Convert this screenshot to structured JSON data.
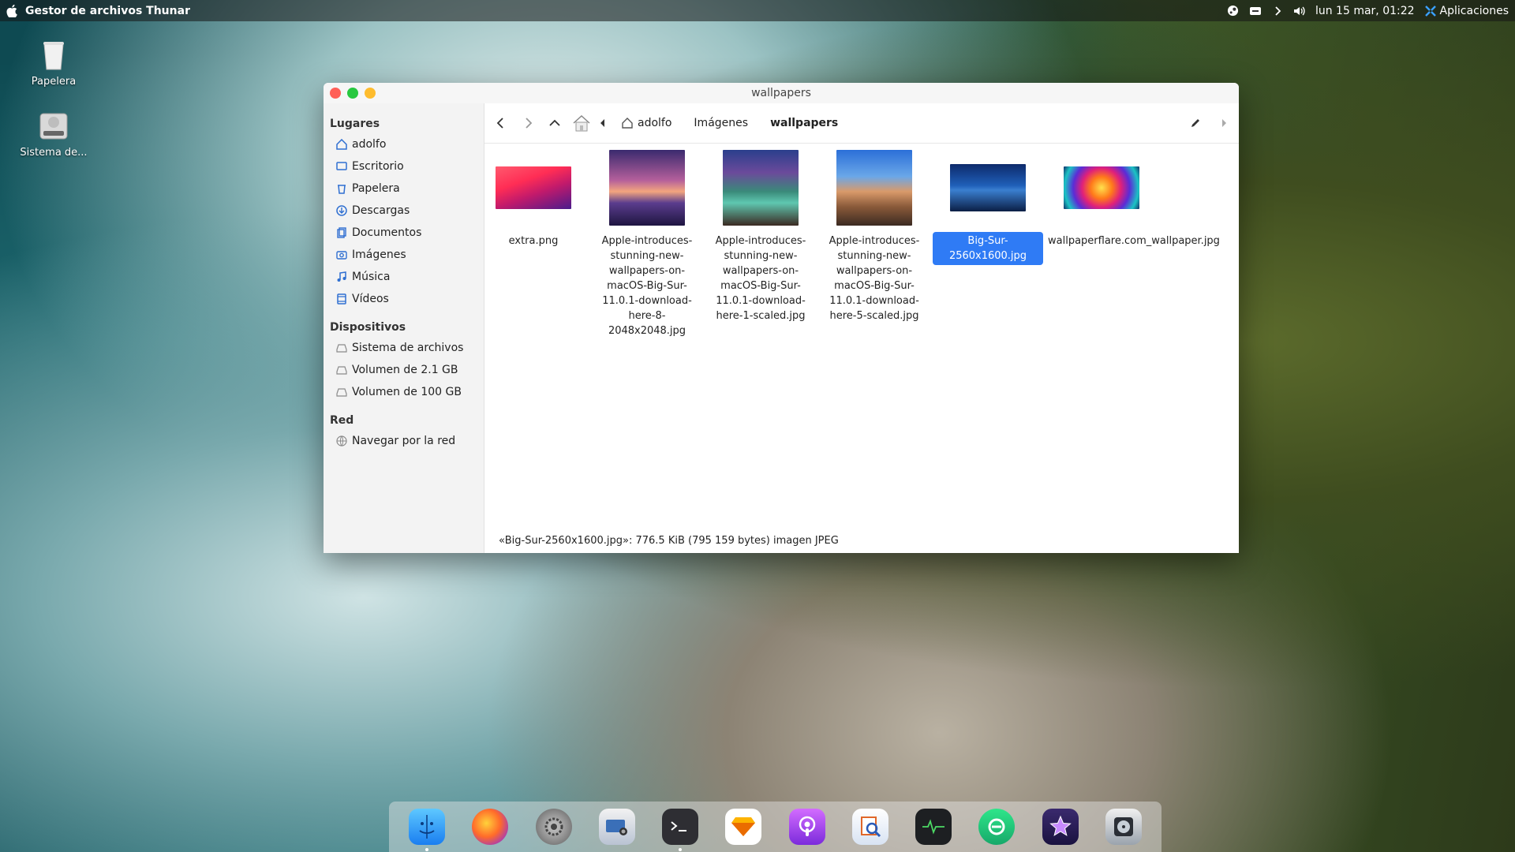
{
  "menubar": {
    "app_name": "Gestor de archivos Thunar",
    "clock": "lun 15 mar, 01:22",
    "apps_label": "Aplicaciones"
  },
  "desktop": {
    "icons": [
      {
        "label": "Papelera",
        "icon": "trash-icon"
      },
      {
        "label": "Sistema de...",
        "icon": "hard-drive-icon"
      }
    ]
  },
  "window": {
    "title": "wallpapers",
    "sidebar": {
      "places_title": "Lugares",
      "places": [
        "adolfo",
        "Escritorio",
        "Papelera",
        "Descargas",
        "Documentos",
        "Imágenes",
        "Música",
        "Vídeos"
      ],
      "devices_title": "Dispositivos",
      "devices": [
        "Sistema de archivos",
        "Volumen de 2.1 GB",
        "Volumen de 100 GB"
      ],
      "network_title": "Red",
      "network": [
        "Navegar por la red"
      ]
    },
    "breadcrumbs": [
      "adolfo",
      "Imágenes",
      "wallpapers"
    ],
    "files": [
      {
        "name": "extra.png",
        "selected": false
      },
      {
        "name": "Apple-introduces-stunning-new-wallpapers-on-macOS-Big-Sur-11.0.1-download-here-8-2048x2048.jpg",
        "selected": false
      },
      {
        "name": "Apple-introduces-stunning-new-wallpapers-on-macOS-Big-Sur-11.0.1-download-here-1-scaled.jpg",
        "selected": false
      },
      {
        "name": "Apple-introduces-stunning-new-wallpapers-on-macOS-Big-Sur-11.0.1-download-here-5-scaled.jpg",
        "selected": false
      },
      {
        "name": "Big-Sur-2560x1600.jpg",
        "selected": true
      },
      {
        "name": "wallpaperflare.com_wallpaper.jpg",
        "selected": false
      }
    ],
    "status": "«Big-Sur-2560x1600.jpg»: 776.5 KiB (795 159 bytes) imagen JPEG"
  },
  "dock": {
    "apps": [
      "finder-icon",
      "firefox-icon",
      "system-settings-icon",
      "screenshot-icon",
      "terminal-icon",
      "sketch-icon",
      "podcast-icon",
      "preview-icon",
      "activity-monitor-icon",
      "browser-icon",
      "imovie-icon",
      "disk-utility-icon"
    ]
  },
  "colors": {
    "selection": "#2f7bf5",
    "close": "#ff5f57",
    "minimize": "#28c840",
    "maximize": "#febc2e"
  }
}
